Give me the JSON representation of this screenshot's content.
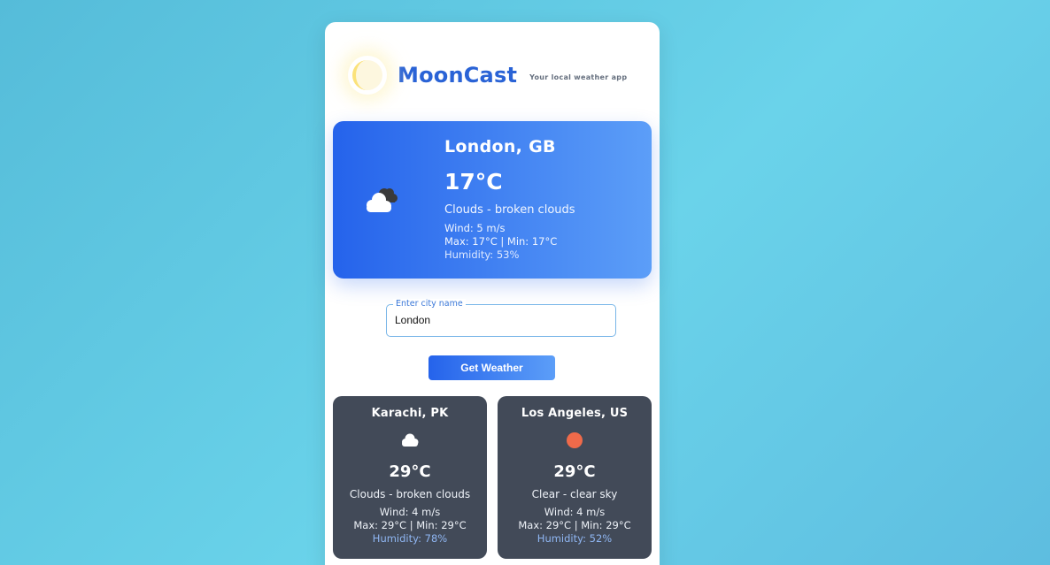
{
  "app": {
    "title": "MoonCast",
    "tagline": "Your local weather app",
    "logo_icon": "moon-icon"
  },
  "current": {
    "city": "London, GB",
    "temperature": "17°C",
    "description": "Clouds - broken clouds",
    "wind": "Wind: 5 m/s",
    "maxmin": "Max: 17°C | Min: 17°C",
    "humidity": "Humidity: 53%",
    "icon": "broken-clouds-icon"
  },
  "search": {
    "label": "Enter city name",
    "value": "London",
    "button_label": "Get Weather"
  },
  "cities": [
    {
      "city": "Karachi, PK",
      "icon": "cloud-icon",
      "temperature": "29°C",
      "description": "Clouds - broken clouds",
      "wind": "Wind: 4 m/s",
      "maxmin": "Max: 29°C | Min: 29°C",
      "humidity": "Humidity: 78%"
    },
    {
      "city": "Los Angeles, US",
      "icon": "sun-icon",
      "temperature": "29°C",
      "description": "Clear - clear sky",
      "wind": "Wind: 4 m/s",
      "maxmin": "Max: 29°C | Min: 29°C",
      "humidity": "Humidity: 52%"
    }
  ],
  "colors": {
    "accent": "#2563eb",
    "accent_light": "#5c9ef8",
    "card_dark": "#424a58",
    "sun": "#ef6a4a",
    "humidity_text": "#8fb6f2"
  }
}
